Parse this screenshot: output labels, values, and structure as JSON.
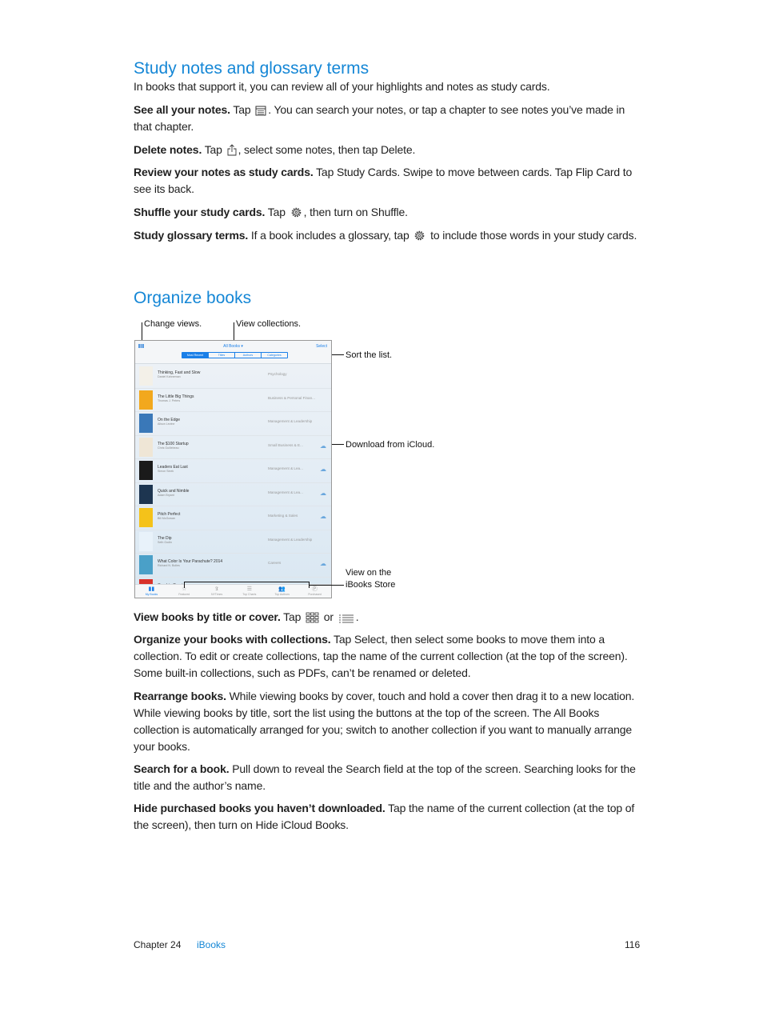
{
  "section1": {
    "heading": "Study notes and glossary terms",
    "intro": "In books that support it, you can review all of your highlights and notes as study cards.",
    "items": [
      {
        "lead": "See all your notes.",
        "t1": " Tap ",
        "icon": "notes-list-icon",
        "t2": ". You can search your notes, or tap a chapter to see notes you’ve made in that chapter."
      },
      {
        "lead": "Delete notes.",
        "t1": " Tap ",
        "icon": "share-icon",
        "t2": ", select some notes, then tap Delete."
      },
      {
        "lead": "Review your notes as study cards.",
        "t1": " Tap Study Cards. Swipe to move between cards. Tap Flip Card to see its back."
      },
      {
        "lead": "Shuffle your study cards.",
        "t1": " Tap ",
        "icon": "gear-icon",
        "t2": ", then turn on Shuffle."
      },
      {
        "lead": "Study glossary terms.",
        "t1": " If a book includes a glossary, tap ",
        "icon": "gear-icon",
        "t2": " to include those words in your study cards."
      }
    ]
  },
  "section2": {
    "heading": "Organize books",
    "figure": {
      "callouts": {
        "change_views": "Change views.",
        "view_collections": "View collections.",
        "sort_list": "Sort the list.",
        "download": "Download from iCloud.",
        "store_line1": "View on the",
        "store_line2": "iBooks Store"
      },
      "screen": {
        "collection": "All Books ▾",
        "select": "Select",
        "sort_tabs": [
          "Most Recent",
          "Titles",
          "Authors",
          "Categories"
        ],
        "books": [
          {
            "title": "Thinking, Fast and Slow",
            "author": "Daniel Kahneman",
            "category": "Psychology",
            "cloud": false,
            "cover": "#f3f0e8"
          },
          {
            "title": "The Little Big Things",
            "author": "Thomas J. Peters",
            "category": "Business & Personal Finan...",
            "cloud": false,
            "cover": "#f2a81d"
          },
          {
            "title": "On the Edge",
            "author": "Alison Levine",
            "category": "Management & Leadership",
            "cloud": false,
            "cover": "#3a78b8"
          },
          {
            "title": "The $100 Startup",
            "author": "Chris Guillebeau",
            "category": "Small Business & E...",
            "cloud": true,
            "cover": "#efe6d6"
          },
          {
            "title": "Leaders Eat Last",
            "author": "Simon Sinek",
            "category": "Management & Lea...",
            "cloud": true,
            "cover": "#1a1a1a"
          },
          {
            "title": "Quick and Nimble",
            "author": "Adam Bryant",
            "category": "Management & Lea...",
            "cloud": true,
            "cover": "#1d3550"
          },
          {
            "title": "Pitch Perfect",
            "author": "Bill McGowan",
            "category": "Marketing & Sales",
            "cloud": true,
            "cover": "#f4c21a"
          },
          {
            "title": "The Dip",
            "author": "Seth Godin",
            "category": "Management & Leadership",
            "cloud": false,
            "cover": "#e8f2fa"
          },
          {
            "title": "What Color Is Your Parachute? 2014",
            "author": "Richard N. Bolles",
            "category": "Careers",
            "cloud": true,
            "cover": "#4aa0c8"
          },
          {
            "title": "Good to Great",
            "author": "",
            "category": "",
            "cloud": true,
            "cover": "#d8322a"
          }
        ],
        "tabbar": [
          {
            "label": "My Books",
            "icon": "book-icon",
            "active": true
          },
          {
            "label": "Featured",
            "icon": "star-icon",
            "active": false
          },
          {
            "label": "NYTimes",
            "icon": "nytimes-icon",
            "active": false
          },
          {
            "label": "Top Charts",
            "icon": "list-icon",
            "active": false
          },
          {
            "label": "Top Authors",
            "icon": "people-icon",
            "active": false
          },
          {
            "label": "Purchased",
            "icon": "purchased-icon",
            "active": false
          }
        ]
      }
    },
    "items": [
      {
        "lead": "View books by title or cover.",
        "t1": " Tap ",
        "t2": " or ",
        "t3": "."
      },
      {
        "lead": "Organize your books with collections.",
        "t1": " Tap Select, then select some books to move them into a collection. To edit or create collections, tap the name of the current collection (at the top of the screen). Some built-in collections, such as PDFs, can’t be renamed or deleted."
      },
      {
        "lead": "Rearrange books.",
        "t1": " While viewing books by cover, touch and hold a cover then drag it to a new location. While viewing books by title, sort the list using the buttons at the top of the screen. The All Books collection is automatically arranged for you; switch to another collection if you want to manually arrange your books."
      },
      {
        "lead": "Search for a book.",
        "t1": " Pull down to reveal the Search field at the top of the screen. Searching looks for the title and the author’s name."
      },
      {
        "lead": "Hide purchased books you haven’t downloaded.",
        "t1": " Tap the name of the current collection (at the top of the screen), then turn on Hide iCloud Books."
      }
    ]
  },
  "footer": {
    "chapter": "Chapter  24",
    "chapter_name": "iBooks",
    "page": "116"
  },
  "colors": {
    "heading": "#1587d6",
    "link": "#1587d6",
    "ios_blue": "#1a7fe8"
  }
}
